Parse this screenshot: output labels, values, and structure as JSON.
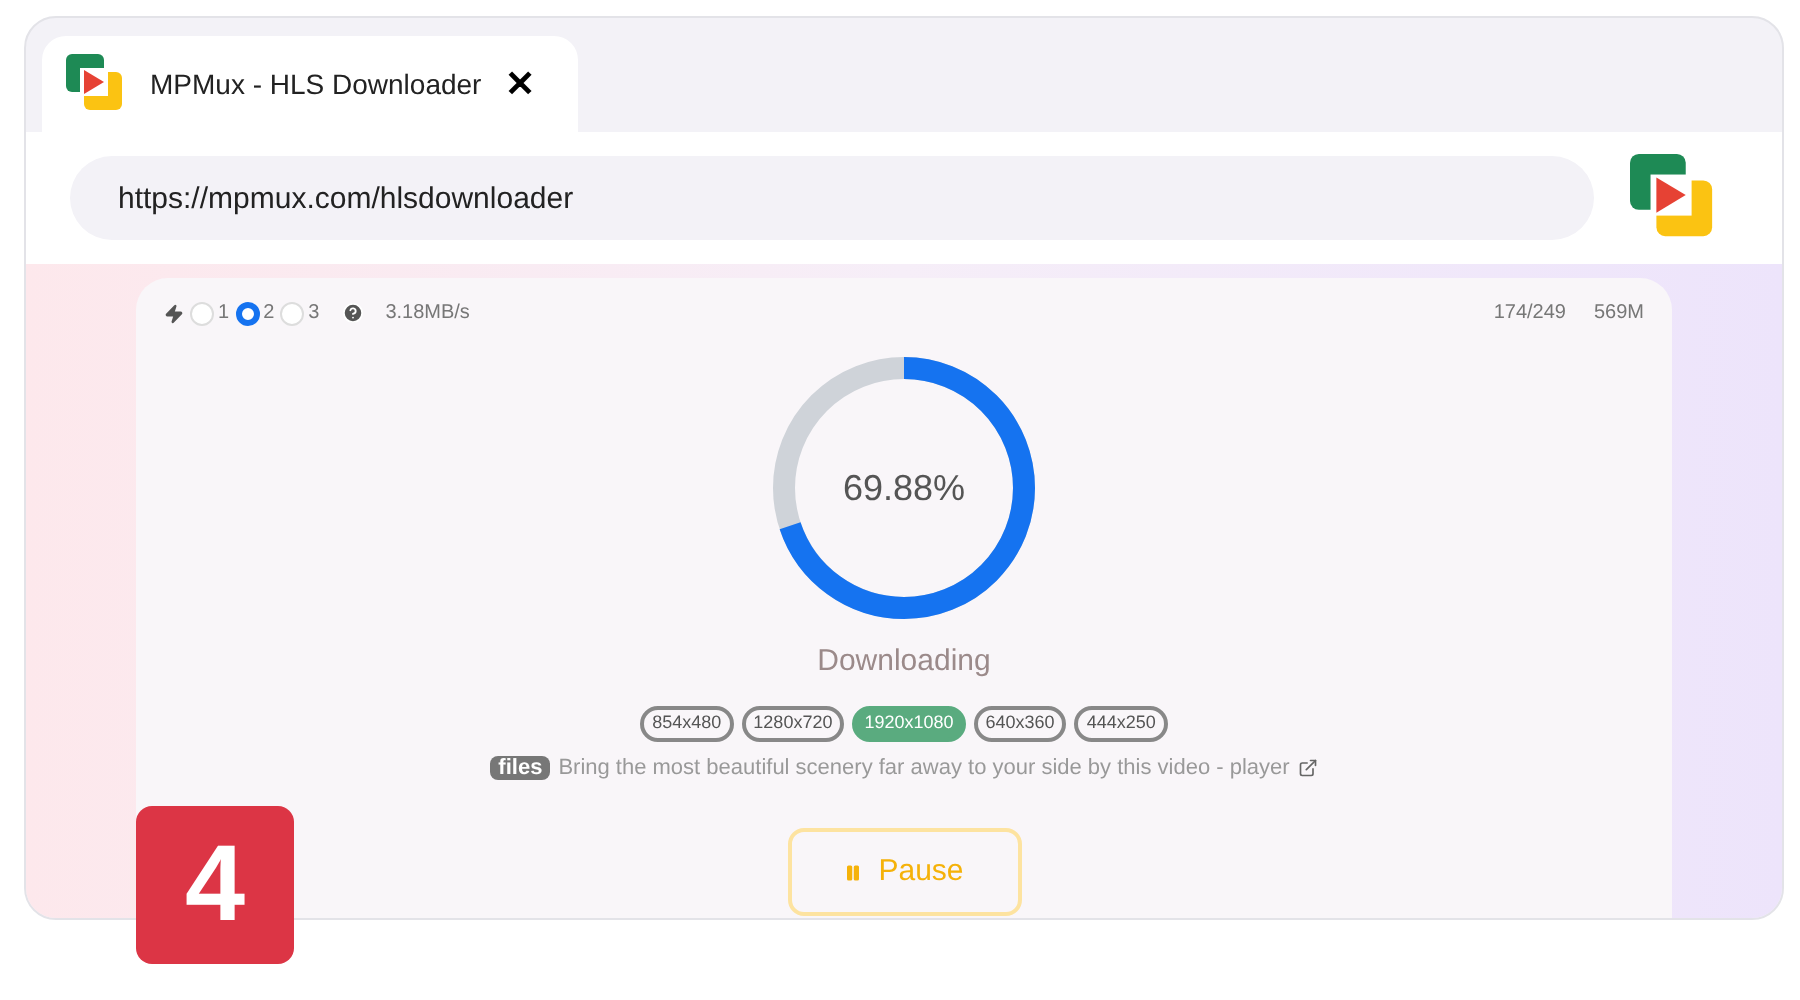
{
  "tab": {
    "title": "MPMux - HLS Downloader",
    "close": "✕"
  },
  "address_bar": {
    "value": "https://mpmux.com/hlsdownloader"
  },
  "threads": [
    {
      "label": "1",
      "selected": false
    },
    {
      "label": "2",
      "selected": true
    },
    {
      "label": "3",
      "selected": false
    }
  ],
  "speed": "3.18MB/s",
  "segments": "174/249",
  "size": "569M",
  "progress": {
    "level": 0.6988,
    "reading": "69.88%"
  },
  "status": "Downloading",
  "resolutions": [
    {
      "label": "854x480",
      "selected": false
    },
    {
      "label": "1280x720",
      "selected": false
    },
    {
      "label": "1920x1080",
      "selected": true
    },
    {
      "label": "640x360",
      "selected": false
    },
    {
      "label": "444x250",
      "selected": false
    }
  ],
  "file": {
    "tag": "files",
    "name": "Bring the most beautiful scenery far away to your side by this video - player"
  },
  "pause_button": {
    "label": "Pause"
  },
  "step_badge": "4"
}
